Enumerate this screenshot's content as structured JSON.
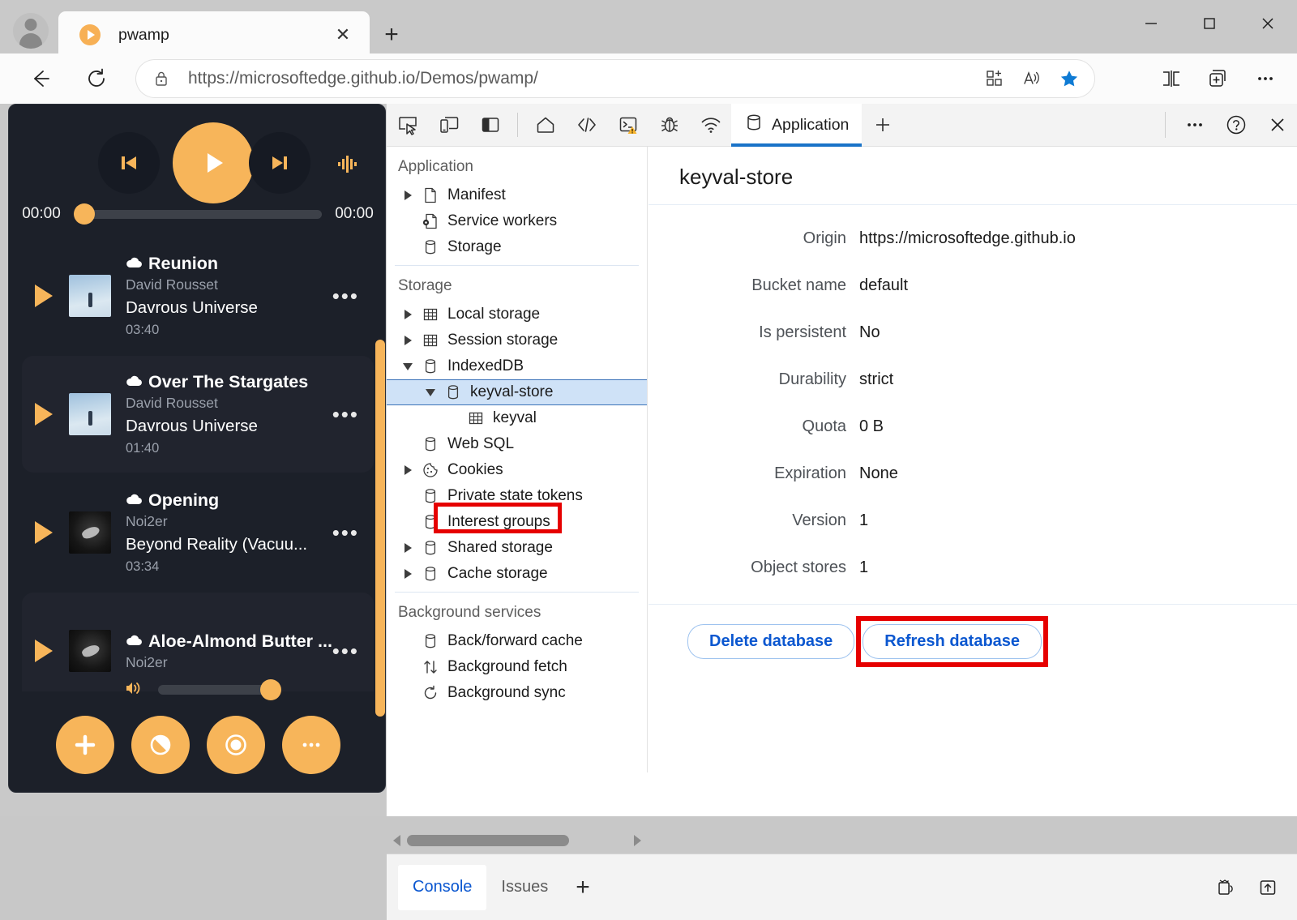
{
  "browser": {
    "tab": {
      "title": "pwamp",
      "favicon": "play-circle-icon",
      "close": "✕"
    },
    "new_tab_label": "+",
    "window_controls": {
      "minimize": "—",
      "maximize": "□",
      "close": "✕"
    },
    "address": {
      "lock_icon": "lock-icon",
      "scheme": "https://",
      "host": "microsoftedge.github.io",
      "path": "/Demos/pwamp/",
      "full": "https://microsoftedge.github.io/Demos/pwamp/"
    },
    "address_icons": [
      "collections-add-icon",
      "read-aloud-icon",
      "favorite-star-icon"
    ],
    "nav_icons": [
      "back-arrow-icon",
      "reload-icon"
    ],
    "right_icons": [
      "split-screen-icon",
      "add-tab-to-collection-icon",
      "settings-more-icon"
    ],
    "accent_blue": "#0f7bd4"
  },
  "player": {
    "transport": {
      "previous": "previous-track-icon",
      "play": "play-icon",
      "next": "next-track-icon",
      "visualizer": "equalizer-icon"
    },
    "elapsed": "00:00",
    "remaining": "00:00",
    "accent": "#f7b55a",
    "background": "#1c2029",
    "songs": [
      {
        "title": "Reunion",
        "artist": "David Rousset",
        "album": "Davrous Universe",
        "duration": "03:40",
        "art": "blue",
        "highlighted": false
      },
      {
        "title": "Over The Stargates",
        "artist": "David Rousset",
        "album": "Davrous Universe",
        "duration": "01:40",
        "art": "blue",
        "highlighted": true
      },
      {
        "title": "Opening",
        "artist": "Noi2er",
        "album": "Beyond Reality (Vacuu...",
        "duration": "03:34",
        "art": "dark",
        "highlighted": false
      },
      {
        "title": "Aloe-Almond Butter ...",
        "artist": "Noi2er",
        "album": "",
        "duration": "",
        "art": "dark",
        "highlighted": true
      }
    ],
    "more_glyph": "•••",
    "volume_icon": "volume-icon",
    "bottom_buttons": [
      "add-icon",
      "theme-icon",
      "record-icon",
      "more-icon"
    ]
  },
  "devtools": {
    "toolbar": {
      "left_icons": [
        "inspect-element-icon",
        "device-emulation-icon",
        "dock-side-icon"
      ],
      "panel_icons": [
        "welcome-home-icon",
        "elements-icon",
        "console-warning-icon",
        "sources-debugger-icon",
        "network-icon"
      ],
      "active_tab": {
        "label": "Application",
        "icon": "application-icon"
      },
      "add_tab": "+",
      "right_icons": [
        "more-options-icon",
        "help-icon",
        "close-devtools-icon"
      ],
      "active_underline": "#1a73c8"
    },
    "sidebar": {
      "sections": [
        {
          "title": "Application",
          "items": [
            {
              "label": "Manifest",
              "icon": "document-icon",
              "arrow": "right",
              "indent": 0,
              "selected": false
            },
            {
              "label": "Service workers",
              "icon": "service-worker-icon",
              "arrow": "none",
              "indent": 0,
              "selected": false
            },
            {
              "label": "Storage",
              "icon": "database-icon",
              "arrow": "none",
              "indent": 0,
              "selected": false
            }
          ]
        },
        {
          "title": "Storage",
          "items": [
            {
              "label": "Local storage",
              "icon": "table-icon",
              "arrow": "right",
              "indent": 0,
              "selected": false
            },
            {
              "label": "Session storage",
              "icon": "table-icon",
              "arrow": "right",
              "indent": 0,
              "selected": false
            },
            {
              "label": "IndexedDB",
              "icon": "database-icon",
              "arrow": "down",
              "indent": 0,
              "selected": false
            },
            {
              "label": "keyval-store",
              "icon": "database-icon",
              "arrow": "down",
              "indent": 1,
              "selected": true
            },
            {
              "label": "keyval",
              "icon": "table-icon",
              "arrow": "none",
              "indent": 2,
              "selected": false
            },
            {
              "label": "Web SQL",
              "icon": "database-icon",
              "arrow": "none",
              "indent": 0,
              "selected": false
            },
            {
              "label": "Cookies",
              "icon": "cookie-icon",
              "arrow": "right",
              "indent": 0,
              "selected": false
            },
            {
              "label": "Private state tokens",
              "icon": "database-icon",
              "arrow": "none",
              "indent": 0,
              "selected": false
            },
            {
              "label": "Interest groups",
              "icon": "database-icon",
              "arrow": "none",
              "indent": 0,
              "selected": false
            },
            {
              "label": "Shared storage",
              "icon": "database-icon",
              "arrow": "right",
              "indent": 0,
              "selected": false
            },
            {
              "label": "Cache storage",
              "icon": "database-icon",
              "arrow": "right",
              "indent": 0,
              "selected": false
            }
          ]
        },
        {
          "title": "Background services",
          "items": [
            {
              "label": "Back/forward cache",
              "icon": "database-icon",
              "arrow": "none",
              "indent": 0,
              "selected": false
            },
            {
              "label": "Background fetch",
              "icon": "updown-arrows-icon",
              "arrow": "none",
              "indent": 0,
              "selected": false
            },
            {
              "label": "Background sync",
              "icon": "sync-icon",
              "arrow": "none",
              "indent": 0,
              "selected": false
            }
          ]
        }
      ],
      "highlight_color": "#e60000"
    },
    "main": {
      "title": "keyval-store",
      "properties": [
        {
          "key": "Origin",
          "value": "https://microsoftedge.github.io"
        },
        {
          "key": "Bucket name",
          "value": "default"
        },
        {
          "key": "Is persistent",
          "value": "No"
        },
        {
          "key": "Durability",
          "value": "strict"
        },
        {
          "key": "Quota",
          "value": "0 B"
        },
        {
          "key": "Expiration",
          "value": "None"
        },
        {
          "key": "Version",
          "value": "1"
        },
        {
          "key": "Object stores",
          "value": "1"
        }
      ],
      "buttons": [
        {
          "label": "Delete database",
          "highlighted": false
        },
        {
          "label": "Refresh database",
          "highlighted": true
        }
      ]
    },
    "drawer": {
      "tabs": [
        {
          "label": "Console",
          "active": true
        },
        {
          "label": "Issues",
          "active": false
        }
      ],
      "add": "+",
      "right_icons": [
        "network-conditions-icon",
        "export-icon"
      ]
    }
  }
}
